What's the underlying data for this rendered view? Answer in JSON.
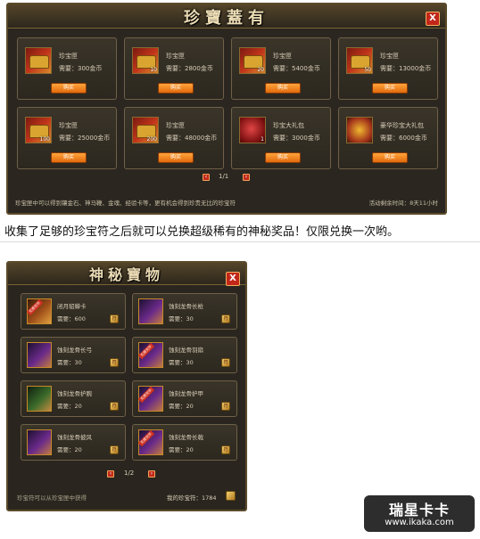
{
  "panel1": {
    "title": "珍寶蓋有",
    "close": "X",
    "buy_label": "购买",
    "items": [
      {
        "name": "珍宝匣",
        "price": "需要：300金币",
        "qty": "",
        "icon": "treasure-chest-icon"
      },
      {
        "name": "珍宝匣",
        "price": "需要：2800金币",
        "qty": "10",
        "icon": "treasure-chest-icon"
      },
      {
        "name": "珍宝匣",
        "price": "需要：5400金币",
        "qty": "20",
        "icon": "treasure-chest-icon"
      },
      {
        "name": "珍宝匣",
        "price": "需要：13000金币",
        "qty": "50",
        "icon": "treasure-chest-icon"
      },
      {
        "name": "珍宝匣",
        "price": "需要：25000金币",
        "qty": "100",
        "icon": "treasure-chest-icon"
      },
      {
        "name": "珍宝匣",
        "price": "需要：48000金币",
        "qty": "200",
        "icon": "treasure-chest-icon"
      },
      {
        "name": "珍宝大礼包",
        "price": "需要：3000金币",
        "qty": "1",
        "icon": "red-bag-icon"
      },
      {
        "name": "豪华珍宝大礼包",
        "price": "需要：6000金币",
        "qty": "",
        "icon": "gift-box-icon"
      }
    ],
    "page": "1/1",
    "footer_left": "珍宝匣中可以得到镶金石、神马鞭、金魂、经验卡等，更有机会得到珍贵无比的珍宝符",
    "footer_right": "活动剩余时间：8天11小时"
  },
  "caption": "收集了足够的珍宝符之后就可以兑换超级稀有的神秘奖品！仅限兑换一次哟。",
  "panel2": {
    "title": "神秘寶物",
    "close": "X",
    "ribbon": "兑换完毕",
    "items": [
      {
        "name": "闭月貂蝉卡",
        "price": "需要：600",
        "redeemed": true,
        "style": "orange"
      },
      {
        "name": "蚀刻龙骨长枪",
        "price": "需要：30",
        "redeemed": false,
        "style": "purple"
      },
      {
        "name": "蚀刻龙骨长弓",
        "price": "需要：30",
        "redeemed": false,
        "style": "purple"
      },
      {
        "name": "蚀刻龙骨羽扇",
        "price": "需要：30",
        "redeemed": true,
        "style": "purple"
      },
      {
        "name": "蚀刻龙骨护腕",
        "price": "需要：20",
        "redeemed": false,
        "style": "green"
      },
      {
        "name": "蚀刻龙骨护甲",
        "price": "需要：20",
        "redeemed": true,
        "style": "purple"
      },
      {
        "name": "蚀刻龙骨披风",
        "price": "需要：20",
        "redeemed": false,
        "style": "purple"
      },
      {
        "name": "蚀刻龙骨长戟",
        "price": "需要：20",
        "redeemed": true,
        "style": "purple"
      }
    ],
    "page": "1/2",
    "footer_left": "珍宝符可以从珍宝匣中获得",
    "footer_right": "我的珍宝符：1784"
  },
  "watermark": {
    "title": "瑞星卡卡",
    "url": "www.ikaka.com"
  }
}
